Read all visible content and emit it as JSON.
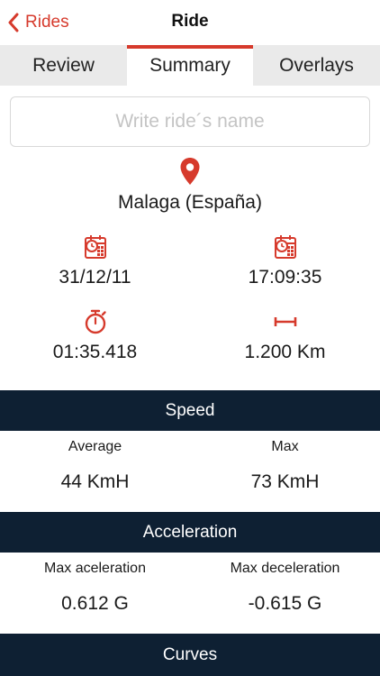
{
  "nav": {
    "back_label": "Rides",
    "title": "Ride"
  },
  "tabs": [
    {
      "label": "Review",
      "active": false
    },
    {
      "label": "Summary",
      "active": true
    },
    {
      "label": "Overlays",
      "active": false
    }
  ],
  "name_field": {
    "placeholder": "Write ride´s name",
    "value": ""
  },
  "location": {
    "text": "Malaga (España)",
    "icon": "location-pin-icon"
  },
  "stats": {
    "date": {
      "value": "31/12/11",
      "icon": "calendar-clock-icon"
    },
    "time": {
      "value": "17:09:35",
      "icon": "calendar-clock-icon"
    },
    "duration": {
      "value": "01:35.418",
      "icon": "stopwatch-icon"
    },
    "distance": {
      "value": "1.200 Km",
      "icon": "distance-ruler-icon"
    }
  },
  "sections": {
    "speed": {
      "title": "Speed",
      "left_label": "Average",
      "left_value": "44 KmH",
      "right_label": "Max",
      "right_value": "73 KmH"
    },
    "acceleration": {
      "title": "Acceleration",
      "left_label": "Max aceleration",
      "left_value": "0.612 G",
      "right_label": "Max deceleration",
      "right_value": "-0.615 G"
    },
    "curves": {
      "title": "Curves"
    }
  },
  "colors": {
    "accent": "#d63a2c",
    "band": "#0e2033",
    "tab_bg": "#eaeaea"
  }
}
